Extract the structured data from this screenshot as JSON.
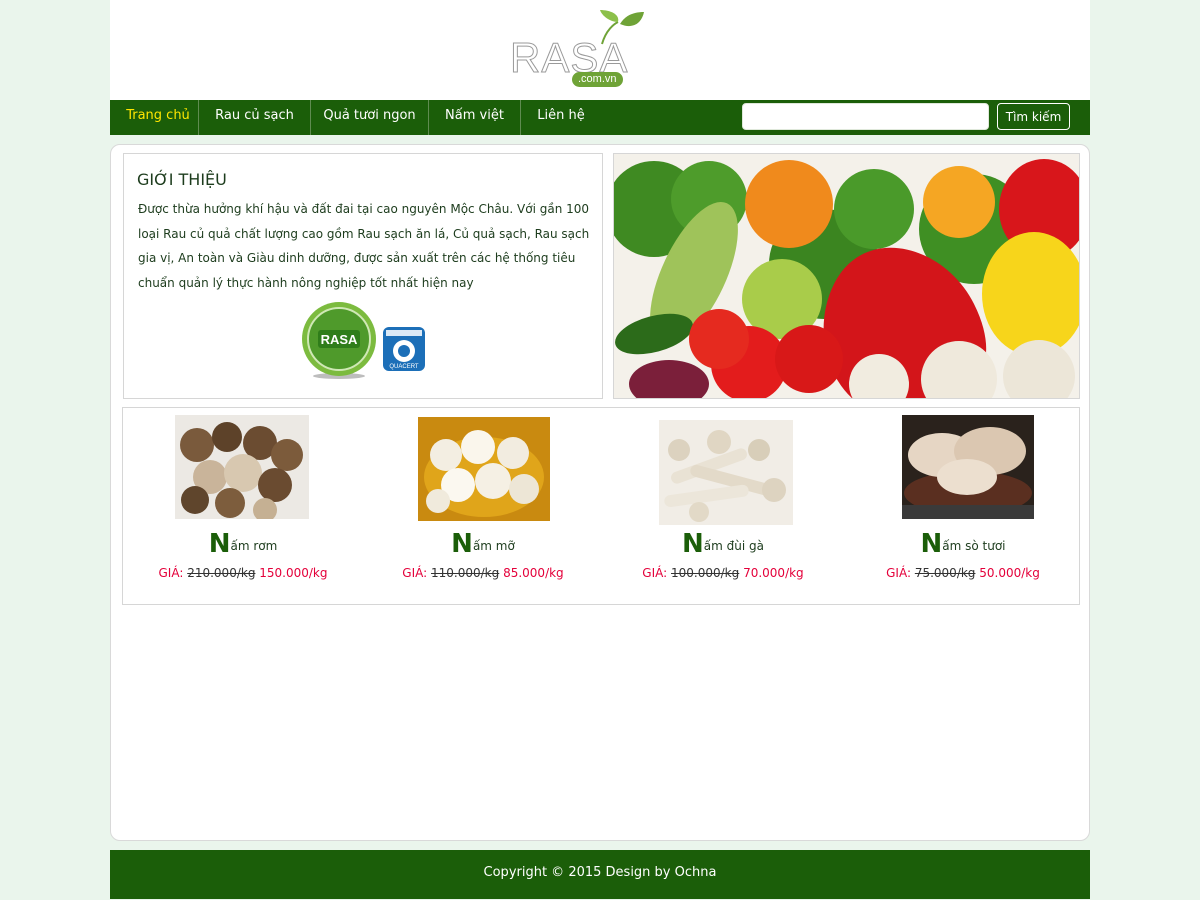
{
  "header": {
    "logo_text": "RASA",
    "logo_sub": ".com.vn"
  },
  "nav": {
    "items": [
      {
        "label": "Trang chủ",
        "active": true
      },
      {
        "label": "Rau củ sạch"
      },
      {
        "label": "Quả tươi ngon"
      },
      {
        "label": "Nấm việt"
      },
      {
        "label": "Liên hệ"
      }
    ],
    "search_value": "",
    "search_button": "Tìm kiếm"
  },
  "intro": {
    "title": "GIỚI THIỆU",
    "text": "Được thừa hưởng khí hậu và đất đai tại cao nguyên Mộc Châu. Với gần 100 loại Rau củ quả chất lượng cao gồm Rau  sạch ăn lá, Củ quả sạch, Rau sạch gia vị, An toàn và Giàu dinh dưỡng, được sản xuất trên các hệ thống tiêu chuẩn quản lý thực hành nông nghiệp tốt nhất hiện nay",
    "badge1": "RASA",
    "badge2": "QUACERT"
  },
  "products": [
    {
      "first": "N",
      "rest": "ấm rơm",
      "price_label": "GIÁ:",
      "old": "210.000/kg",
      "new": "150.000/kg"
    },
    {
      "first": "N",
      "rest": "ấm mỡ",
      "price_label": "GIÁ:",
      "old": "110.000/kg",
      "new": "85.000/kg"
    },
    {
      "first": "N",
      "rest": "ấm đùi gà",
      "price_label": "GIÁ:",
      "old": "100.000/kg",
      "new": "70.000/kg"
    },
    {
      "first": "N",
      "rest": "ấm sò tươi",
      "price_label": "GIÁ:",
      "old": "75.000/kg",
      "new": "50.000/kg"
    }
  ],
  "footer": {
    "text": "Copyright © 2015 Design by Ochna"
  },
  "colors": {
    "nav_bg": "#1b5e09",
    "active": "#ffe600",
    "price_new": "#e4003a",
    "page_bg": "#eaf5ec"
  }
}
